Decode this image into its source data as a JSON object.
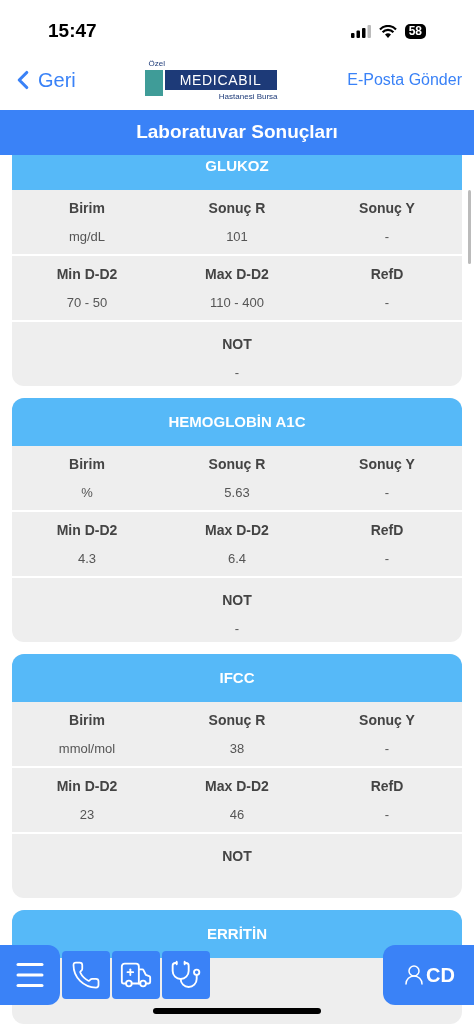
{
  "status_bar": {
    "time": "15:47",
    "battery": "58"
  },
  "nav": {
    "back": "Geri",
    "logo": {
      "prefix": "Özel",
      "name": "MEDICABIL",
      "subtitle": "Hastanesi Bursa"
    },
    "action": "E-Posta Gönder"
  },
  "title": "Laboratuvar Sonuçları",
  "results": [
    {
      "name": "GLUKOZ",
      "fields": [
        {
          "label": "Birim",
          "value": "mg/dL"
        },
        {
          "label": "Sonuç R",
          "value": "101"
        },
        {
          "label": "Sonuç Y",
          "value": "-"
        },
        {
          "label": "Min D-D2",
          "value": "70 - 50"
        },
        {
          "label": "Max D-D2",
          "value": "110 - 400"
        },
        {
          "label": "RefD",
          "value": "-"
        }
      ],
      "note": {
        "label": "NOT",
        "value": "-"
      }
    },
    {
      "name": "HEMOGLOBİN A1C",
      "fields": [
        {
          "label": "Birim",
          "value": "%"
        },
        {
          "label": "Sonuç R",
          "value": "5.63"
        },
        {
          "label": "Sonuç Y",
          "value": "-"
        },
        {
          "label": "Min D-D2",
          "value": "4.3"
        },
        {
          "label": "Max D-D2",
          "value": "6.4"
        },
        {
          "label": "RefD",
          "value": "-"
        }
      ],
      "note": {
        "label": "NOT",
        "value": "-"
      }
    },
    {
      "name": "IFCC",
      "fields": [
        {
          "label": "Birim",
          "value": "mmol/mol"
        },
        {
          "label": "Sonuç R",
          "value": "38"
        },
        {
          "label": "Sonuç Y",
          "value": "-"
        },
        {
          "label": "Min D-D2",
          "value": "23"
        },
        {
          "label": "Max D-D2",
          "value": "46"
        },
        {
          "label": "RefD",
          "value": "-"
        }
      ],
      "note": {
        "label": "NOT"
      }
    },
    {
      "name": "ERRİTİN"
    }
  ],
  "bottom_bar": {
    "right_label": "CD"
  }
}
